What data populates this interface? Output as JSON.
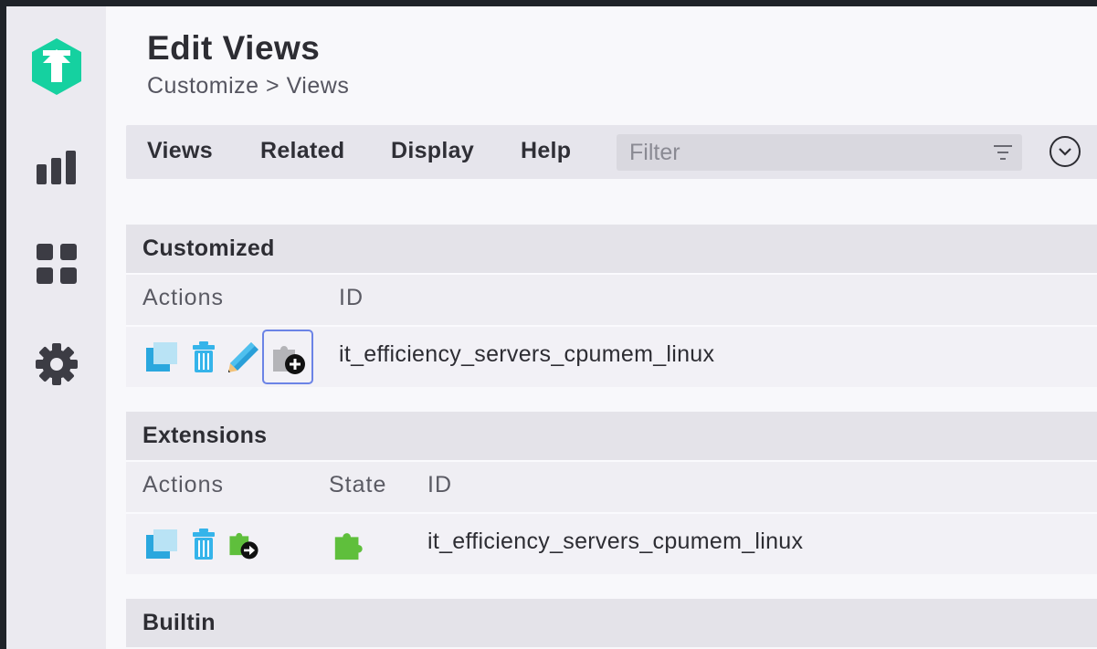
{
  "page": {
    "title": "Edit Views",
    "breadcrumb": "Customize > Views"
  },
  "sidebar": {
    "items": [
      {
        "name": "logo",
        "icon": "checkmk-logo-icon"
      },
      {
        "name": "monitor",
        "icon": "bar-chart-icon"
      },
      {
        "name": "customize",
        "icon": "grid-icon"
      },
      {
        "name": "setup",
        "icon": "gear-icon"
      }
    ]
  },
  "menubar": {
    "items": [
      "Views",
      "Related",
      "Display",
      "Help"
    ],
    "filter_placeholder": "Filter"
  },
  "sections": {
    "customized": {
      "title": "Customized",
      "columns": {
        "actions": "Actions",
        "id": "ID"
      },
      "row": {
        "id": "it_efficiency_servers_cpumem_linux"
      }
    },
    "extensions": {
      "title": "Extensions",
      "columns": {
        "actions": "Actions",
        "state": "State",
        "id": "ID"
      },
      "row": {
        "id": "it_efficiency_servers_cpumem_linux"
      }
    },
    "builtin": {
      "title": "Builtin"
    }
  },
  "colors": {
    "brand": "#15d1a0",
    "clone_blue": "#2aa7de",
    "trash_blue": "#35b4ea",
    "extension_green": "#5fbf3c",
    "highlight_outline": "#6b83e6"
  }
}
